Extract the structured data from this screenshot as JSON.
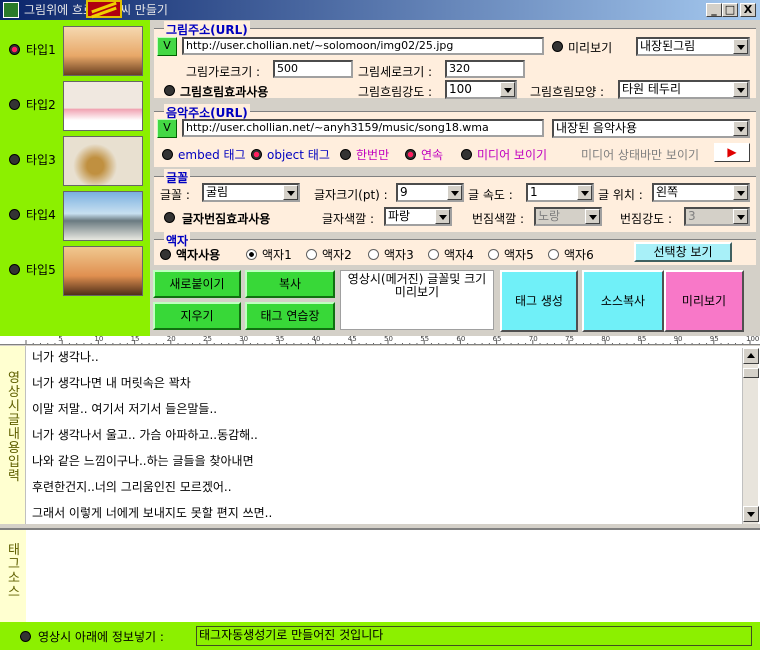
{
  "window": {
    "title": "그림위에 흐르는 글씨 만들기",
    "btn_min": "_",
    "btn_max": "□",
    "btn_close": "X"
  },
  "types": [
    {
      "label": "타입1",
      "selected": true
    },
    {
      "label": "타입2",
      "selected": false
    },
    {
      "label": "타입3",
      "selected": false
    },
    {
      "label": "타입4",
      "selected": false
    },
    {
      "label": "타입5",
      "selected": false
    }
  ],
  "image": {
    "title": "그림주소(URL)",
    "v": "V",
    "url": "http://user.chollian.net/~solomoon/img02/25.jpg",
    "preview_label": "미리보기",
    "builtin": "내장된그림",
    "width_label": "그림가로크기 :",
    "width_value": "500",
    "height_label": "그림세로크기 :",
    "height_value": "320",
    "blur_effect_label": "그림흐림효과사용",
    "blur_strength_label": "그림흐림강도 :",
    "blur_strength_value": "100",
    "blur_shape_label": "그림흐림모양 :",
    "blur_shape_value": "타원 테두리"
  },
  "music": {
    "title": "음악주소(URL)",
    "v": "V",
    "url": "http://user.chollian.net/~anyh3159/music/song18.wma",
    "builtin": "내장된 음악사용",
    "embed_label": "embed 태그",
    "object_label": "object 태그",
    "once_label": "한번만",
    "loop_label": "연속",
    "show_media_label": "미디어 보이기",
    "status_only_label": "미디어 상태바만 보이기",
    "play_icon": "▶"
  },
  "font": {
    "title": "글꼴",
    "face_label": "글꼴 :",
    "face_value": "굴림",
    "size_label": "글자크기(pt) :",
    "size_value": "9",
    "speed_label": "글 속도 :",
    "speed_value": "1",
    "position_label": "글 위치 :",
    "position_value": "왼쪽",
    "glow_label": "글자번짐효과사용",
    "color_label": "글자색깔 :",
    "color_value": "파랑",
    "glow_color_label": "번짐색깔 :",
    "glow_color_value": "노랑",
    "glow_strength_label": "번짐강도 :",
    "glow_strength_value": "3"
  },
  "frame": {
    "title": "액자",
    "use_label": "액자사용",
    "options": [
      "액자1",
      "액자2",
      "액자3",
      "액자4",
      "액자5",
      "액자6"
    ],
    "selected_index": 0,
    "select_window_label": "선택창 보기"
  },
  "actions": {
    "new_label": "새로붙이기",
    "copy_label": "복사",
    "clear_label": "지우기",
    "practice_label": "태그 연습장",
    "preview_text": "영상시(메거진) 글꼴및 크기 미리보기",
    "generate_label": "태그 생성",
    "source_copy_label": "소스복사",
    "preview_label": "미리보기"
  },
  "ruler_labels": [
    "5",
    "10",
    "15",
    "20",
    "25",
    "30",
    "35",
    "40",
    "45",
    "50",
    "55",
    "60",
    "65",
    "70",
    "75",
    "80",
    "85",
    "90",
    "95",
    "100"
  ],
  "editor": {
    "side_label": "영상시 글내용입력",
    "lines": [
      "너가 생각나..",
      "너가 생각나면 내 머릿속은 꽉차",
      "이말 저말.. 여기서 저기서 들은말들..",
      "너가 생각나서 울고.. 가슴 아파하고..동감해..",
      "나와 같은 느낌이구나..하는 글들을 찾아내면",
      "후련한건지..너의 그리움인진 모르겠어..",
      "그래서 이렇게 너에게 보내지도 못할 편지 쓰면.."
    ]
  },
  "tag_source": {
    "side_label": "태그소스"
  },
  "bottom": {
    "label": "영상시 아래에 정보넣기 :",
    "value": "태그자동생성기로 만들어진 것입니다"
  },
  "colors": {
    "accent_green": "#8cf000",
    "title_blue": "#0000c0",
    "group_bg": "#ffeedd"
  }
}
